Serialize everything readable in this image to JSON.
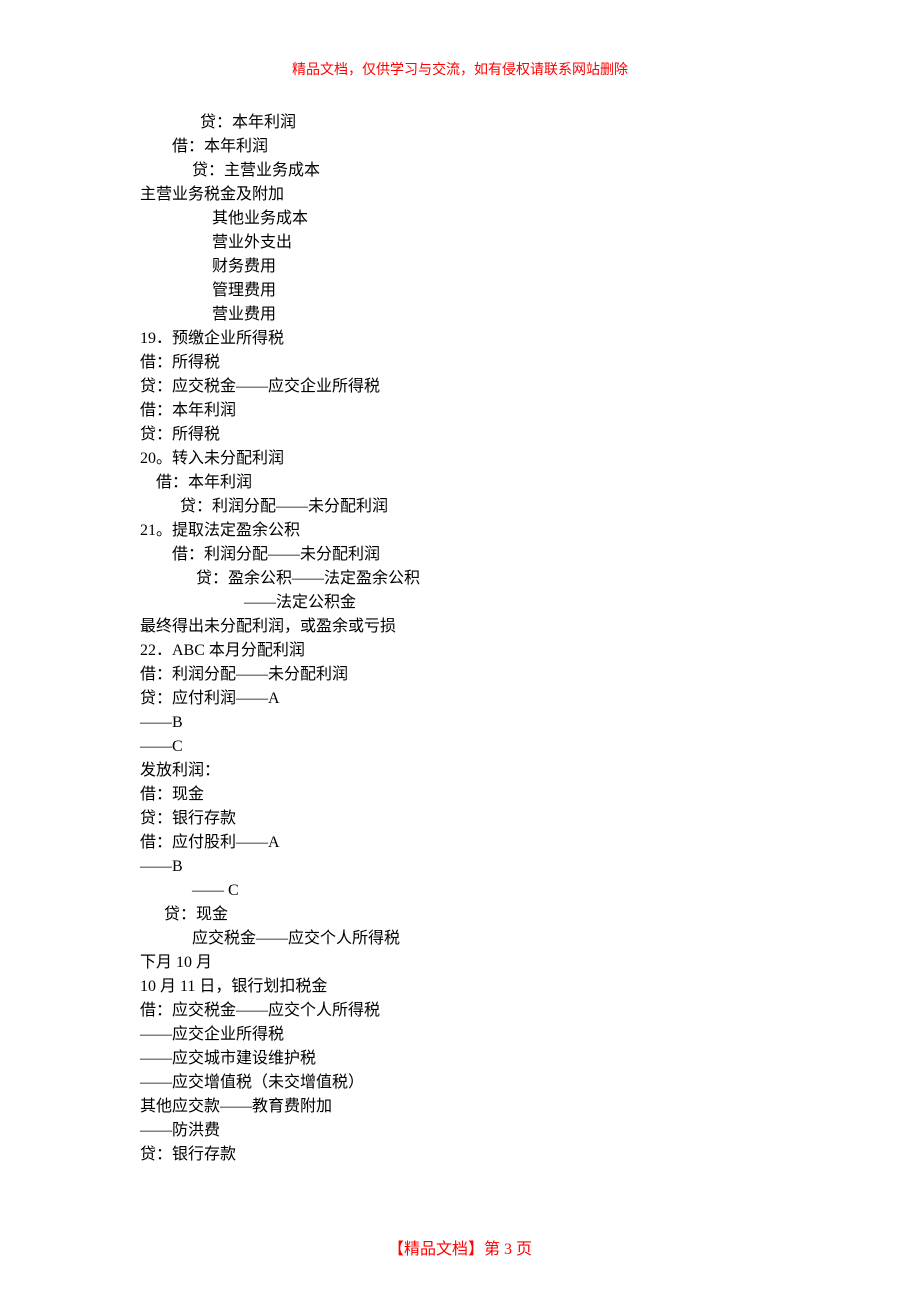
{
  "header": "精品文档，仅供学习与交流，如有侵权请联系网站删除",
  "lines": [
    "               贷：本年利润",
    "        借：本年利润",
    "             贷：主营业务成本",
    "主营业务税金及附加",
    "                  其他业务成本",
    "                  营业外支出",
    "                  财务费用",
    "                  管理费用",
    "                  营业费用",
    "19．预缴企业所得税",
    "借：所得税",
    "贷：应交税金——应交企业所得税",
    "借：本年利润",
    "贷：所得税",
    "20。转入未分配利润",
    "    借：本年利润",
    "          贷：利润分配——未分配利润",
    "21。提取法定盈余公积",
    "        借：利润分配——未分配利润",
    "              贷：盈余公积——法定盈余公积",
    "                          ——法定公积金",
    "最终得出未分配利润，或盈余或亏损",
    "22．ABC 本月分配利润",
    "借：利润分配——未分配利润",
    "贷：应付利润——A",
    "——B",
    "——C",
    "发放利润：",
    "借：现金",
    "贷：银行存款",
    "借：应付股利——A",
    "——B",
    "             —— C",
    "      贷：现金",
    "             应交税金——应交个人所得税",
    "下月 10 月",
    "10 月 11 日，银行划扣税金",
    "借：应交税金——应交个人所得税",
    "——应交企业所得税",
    "——应交城市建设维护税",
    "——应交增值税（未交增值税）",
    "其他应交款——教育费附加",
    "——防洪费",
    "贷：银行存款"
  ],
  "footer": "【精品文档】第  3  页"
}
